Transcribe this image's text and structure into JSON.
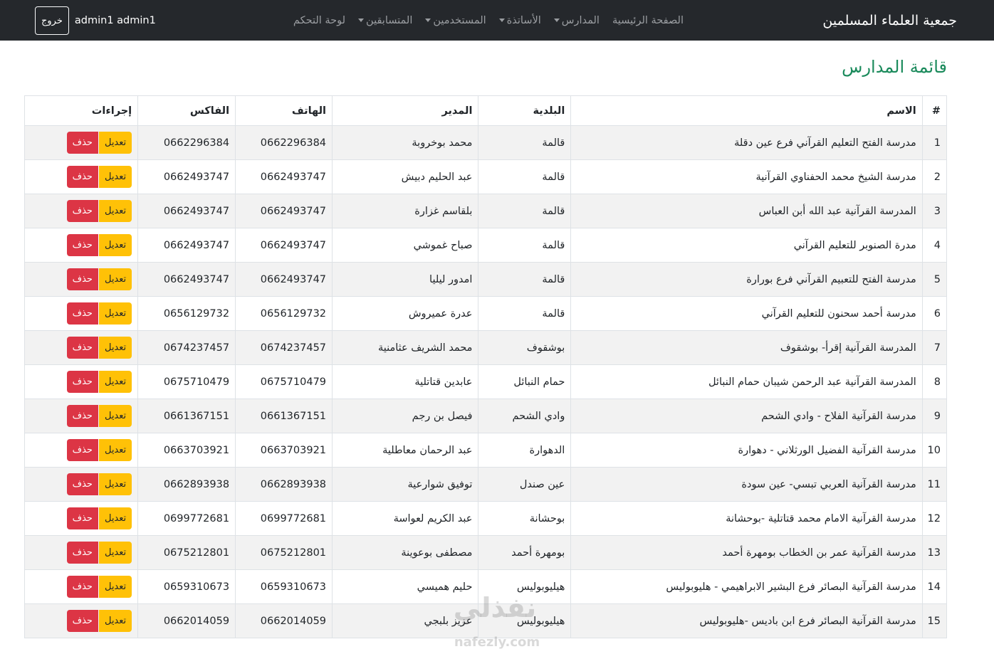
{
  "navbar": {
    "brand": "جمعية العلماء المسلمين",
    "links": [
      {
        "label": "الصفحة الرئيسية",
        "dropdown": false
      },
      {
        "label": "المدارس",
        "dropdown": true
      },
      {
        "label": "الأساتذة",
        "dropdown": true
      },
      {
        "label": "المستخدمين",
        "dropdown": true
      },
      {
        "label": "المتسابقين",
        "dropdown": true
      },
      {
        "label": "لوحة التحكم",
        "dropdown": false
      }
    ],
    "username": "admin1 admin1",
    "logout_label": "خروج"
  },
  "page": {
    "title": "قائمة المدارس"
  },
  "table": {
    "headers": {
      "num": "#",
      "name": "الاسم",
      "municipality": "البلدية",
      "director": "المدير",
      "phone": "الهاتف",
      "fax": "الفاكس",
      "actions": "إجراءات"
    },
    "edit_label": "تعديل",
    "delete_label": "حذف",
    "rows": [
      {
        "num": "1",
        "name": "مدرسة الفتح التعليم القرآني فرع عين دقلة",
        "municipality": "قالمة",
        "director": "محمد بوخروبة",
        "phone": "0662296384",
        "fax": "0662296384"
      },
      {
        "num": "2",
        "name": "مدرسة الشيخ محمد الحفناوي القرآنية",
        "municipality": "قالمة",
        "director": "عبد الحليم دبيش",
        "phone": "0662493747",
        "fax": "0662493747"
      },
      {
        "num": "3",
        "name": "المدرسة القرآنية عبد الله أبن العباس",
        "municipality": "قالمة",
        "director": "بلقاسم غزارة",
        "phone": "0662493747",
        "fax": "0662493747"
      },
      {
        "num": "4",
        "name": "مدرة الصنوبر للتعليم القرآني",
        "municipality": "قالمة",
        "director": "صباح غموشي",
        "phone": "0662493747",
        "fax": "0662493747"
      },
      {
        "num": "5",
        "name": "مدرسة الفتح للتعبيم القرآني فرع بورارة",
        "municipality": "قالمة",
        "director": "امدور ليليا",
        "phone": "0662493747",
        "fax": "0662493747"
      },
      {
        "num": "6",
        "name": "مدرسة أحمد سحنون للتعليم القرآني",
        "municipality": "قالمة",
        "director": "عدرة عميروش",
        "phone": "0656129732",
        "fax": "0656129732"
      },
      {
        "num": "7",
        "name": "المدرسة القرآنية إقرأ- بوشقوف",
        "municipality": "بوشقوف",
        "director": "محمد الشريف عثامنية",
        "phone": "0674237457",
        "fax": "0674237457"
      },
      {
        "num": "8",
        "name": "المدرسة القرآنية عبد الرحمن شيبان حمام النبائل",
        "municipality": "حمام النبائل",
        "director": "عابدين قتاتلية",
        "phone": "0675710479",
        "fax": "0675710479"
      },
      {
        "num": "9",
        "name": "مدرسة القرآنية الفلاح - وادي الشحم",
        "municipality": "وادي الشحم",
        "director": "فيصل بن رجم",
        "phone": "0661367151",
        "fax": "0661367151"
      },
      {
        "num": "10",
        "name": "مدرسة القرآنية الفضيل الورثلاني - دهوارة",
        "municipality": "الدهوارة",
        "director": "عبد الرحمان معاطلية",
        "phone": "0663703921",
        "fax": "0663703921"
      },
      {
        "num": "11",
        "name": "مدرسة القرآنية العربي تبسي- عين سودة",
        "municipality": "عين صندل",
        "director": "توفيق شوارعية",
        "phone": "0662893938",
        "fax": "0662893938"
      },
      {
        "num": "12",
        "name": "مدرسة القرآنية الامام محمد قتاتلية -بوحشانة",
        "municipality": "بوحشانة",
        "director": "عبد الكريم لعواسة",
        "phone": "0699772681",
        "fax": "0699772681"
      },
      {
        "num": "13",
        "name": "مدرسة القرآنية عمر بن الخطاب بومهرة أحمد",
        "municipality": "بومهرة أحمد",
        "director": "مصطفى بوعوينة",
        "phone": "0675212801",
        "fax": "0675212801"
      },
      {
        "num": "14",
        "name": "مدرسة القرآنية البصائر فرع البشير الابراهيمي - هليوبوليس",
        "municipality": "هيليوبوليس",
        "director": "حليم هميسي",
        "phone": "0659310673",
        "fax": "0659310673"
      },
      {
        "num": "15",
        "name": "مدرسة القرآنية البصائر فرع ابن باديس -هليوبوليس",
        "municipality": "هيليوبوليس",
        "director": "عزيز بلبجي",
        "phone": "0662014059",
        "fax": "0662014059"
      }
    ]
  },
  "watermark": {
    "text": "نفذلي",
    "sub": "nafezly.com"
  }
}
